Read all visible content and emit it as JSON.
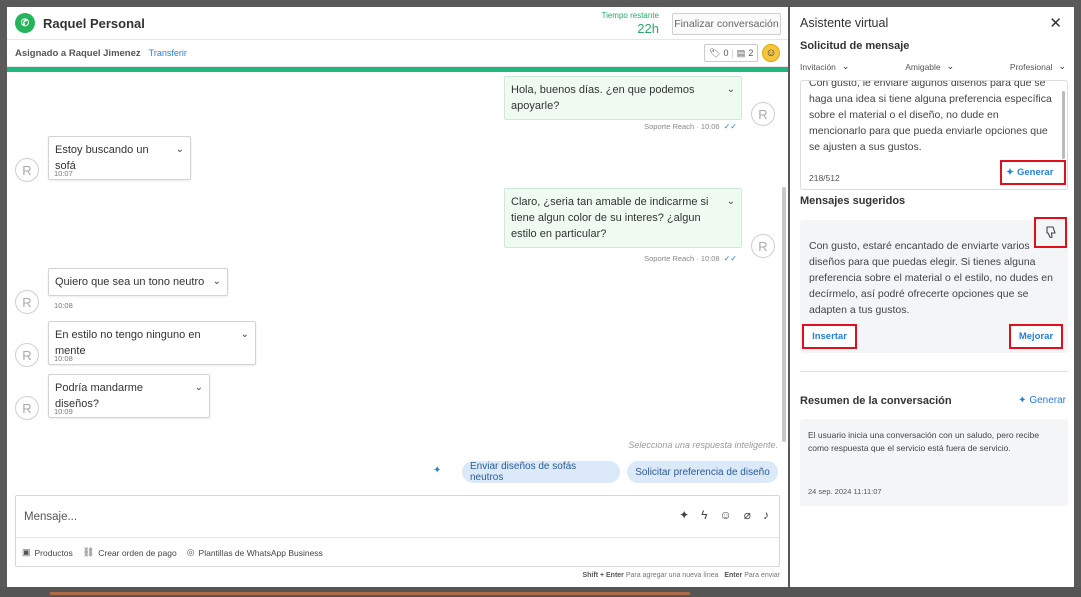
{
  "chat": {
    "contact_name": "Raquel Personal",
    "time_label": "Tiempo restante",
    "time_value": "22h",
    "finalize_label": "Finalizar conversación",
    "assigned_label": "Asignado a Raquel Jimenez",
    "transfer_label": "Transferir",
    "counter_tags": "0",
    "counter_notes": "2",
    "avatar_letter": "R",
    "messages": [
      {
        "dir": "out",
        "text": "Hola, buenos días. ¿en que podemos apoyarle?",
        "sender": "Soporte Reach",
        "time": "10:06"
      },
      {
        "dir": "in",
        "text": "Estoy buscando un sofá",
        "time": "10:07"
      },
      {
        "dir": "out",
        "text": "Claro, ¿seria tan amable de indicarme si tiene algun color de su interes? ¿algun estilo en particular?",
        "sender": "Soporte Reach",
        "time": "10:08"
      },
      {
        "dir": "in",
        "text": "Quiero que sea un tono neutro",
        "time": "10:08"
      },
      {
        "dir": "in",
        "text": "En estilo no tengo ninguno en mente",
        "time": "10:08"
      },
      {
        "dir": "in",
        "text": "Podría mandarme diseños?",
        "time": "10:09"
      }
    ],
    "smart_hint": "Selecciona una respuesta inteligente.",
    "smart_replies": [
      "Enviar diseños de sofás neutros",
      "Solicitar preferencia de diseño"
    ],
    "composer_placeholder": "Mensaje...",
    "tools": {
      "products": "Productos",
      "payment_order": "Crear orden de pago",
      "templates": "Plantillas de WhatsApp Business"
    },
    "kb_hint_shift": "Shift + Enter",
    "kb_hint_shift_text": "Para agregar una nueva línea",
    "kb_hint_enter": "Enter",
    "kb_hint_enter_text": "Para enviar"
  },
  "assistant": {
    "title": "Asistente virtual",
    "request_title": "Solicitud de mensaje",
    "dropdowns": [
      {
        "label": "Invitación"
      },
      {
        "label": "Amigable"
      },
      {
        "label": "Profesional"
      }
    ],
    "request_text": "Con gusto, le enviaré algunos diseños para que se haga una idea si tiene alguna preferencia específica sobre el material o el diseño, no dude en mencionarlo para que pueda enviarle opciones que se ajusten a sus gustos.",
    "char_count": "218/512",
    "generate_label": "Generar",
    "suggested_title": "Mensajes sugeridos",
    "suggested_text": "Con gusto, estaré encantado de enviarte varios diseños para que puedas elegir. Si tienes alguna preferencia sobre el material o el estilo, no dudes en decírmelo, así podré ofrecerte opciones que se adapten a tus gustos.",
    "insert_label": "Insertar",
    "improve_label": "Mejorar",
    "summary_title": "Resumen de la conversación",
    "summary_generate_label": "Generar",
    "summary_text": "El usuario inicia una conversación con un saludo, pero recibe como respuesta que el servicio está fuera de servicio.",
    "summary_date": "24 sep. 2024 11:11:07"
  },
  "colors": {
    "accent_green": "#21b67b",
    "link_blue": "#2a7fd4",
    "highlight_red": "#e0101a"
  }
}
